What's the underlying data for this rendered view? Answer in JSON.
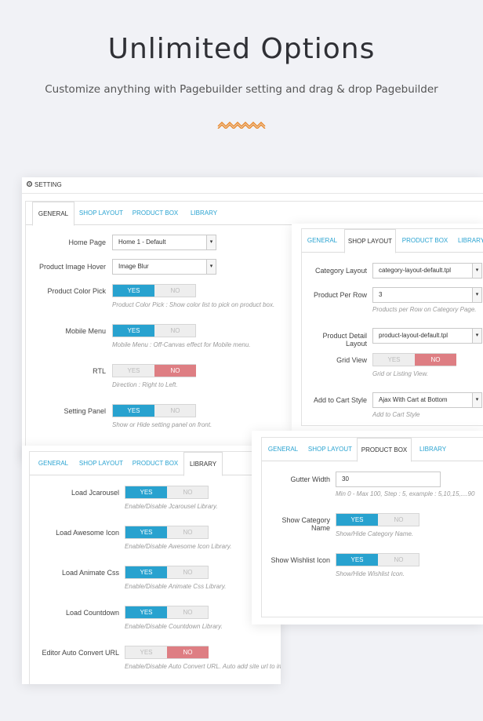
{
  "hero": {
    "title": "Unlimited Options",
    "subtitle": "Customize anything with Pagebuilder setting and drag & drop Pagebuilder",
    "accent_color": "#e8892c"
  },
  "colors": {
    "primary": "#28a2cf",
    "danger": "#de7e83",
    "tab_link": "#2aa3d1"
  },
  "general_panel": {
    "header": "SETTING",
    "tabs": [
      "GENERAL",
      "SHOP LAYOUT",
      "PRODUCT BOX",
      "LIBRARY"
    ],
    "active_tab": "GENERAL",
    "fields": {
      "home_page": {
        "label": "Home Page",
        "value": "Home 1 - Default"
      },
      "product_image_hover": {
        "label": "Product Image Hover",
        "value": "Image Blur"
      },
      "product_color_pick": {
        "label": "Product Color Pick",
        "state": "YES",
        "hint": "Product Color Pick : Show color list to pick on product box."
      },
      "mobile_menu": {
        "label": "Mobile Menu",
        "state": "YES",
        "hint": "Mobile Menu : Off-Canvas effect for Mobile menu."
      },
      "rtl": {
        "label": "RTL",
        "state": "NO",
        "hint": "Direction : Right to Left."
      },
      "setting_panel": {
        "label": "Setting Panel",
        "state": "YES",
        "hint": "Show or Hide setting panel on front."
      }
    }
  },
  "shop_layout_panel": {
    "tabs": [
      "GENERAL",
      "SHOP LAYOUT",
      "PRODUCT BOX",
      "LIBRARY"
    ],
    "active_tab": "SHOP LAYOUT",
    "fields": {
      "category_layout": {
        "label": "Category Layout",
        "value": "category-layout-default.tpl"
      },
      "product_per_row": {
        "label": "Product Per Row",
        "value": "3",
        "hint": "Products per Row on Category Page."
      },
      "product_detail_layout": {
        "label": "Product Detail Layout",
        "value": "product-layout-default.tpl"
      },
      "grid_view": {
        "label": "Grid View",
        "state": "NO",
        "hint": "Grid or Listing View."
      },
      "add_to_cart_style": {
        "label": "Add to Cart Style",
        "value": "Ajax With Cart at Bottom",
        "hint": "Add to Cart Style"
      }
    }
  },
  "library_panel": {
    "tabs": [
      "GENERAL",
      "SHOP LAYOUT",
      "PRODUCT BOX",
      "LIBRARY"
    ],
    "active_tab": "LIBRARY",
    "fields": {
      "load_jcarousel": {
        "label": "Load Jcarousel",
        "state": "YES",
        "hint": "Enable/Disable Jcarousel Library."
      },
      "load_awesome_icon": {
        "label": "Load Awesome Icon",
        "state": "YES",
        "hint": "Enable/Disable Awesome Icon Library."
      },
      "load_animate_css": {
        "label": "Load Animate Css",
        "state": "YES",
        "hint": "Enable/Disable Animate Css Library."
      },
      "load_countdown": {
        "label": "Load Countdown",
        "state": "YES",
        "hint": "Enable/Disable Countdown Library."
      },
      "editor_auto_convert_url": {
        "label": "Editor Auto Convert URL",
        "state": "NO",
        "hint": "Enable/Disable Auto Convert URL. Auto add site url to image src."
      }
    }
  },
  "product_box_panel": {
    "tabs": [
      "GENERAL",
      "SHOP LAYOUT",
      "PRODUCT BOX",
      "LIBRARY"
    ],
    "active_tab": "PRODUCT BOX",
    "fields": {
      "gutter_width": {
        "label": "Gutter Width",
        "value": "30",
        "hint": "Min 0 - Max 100, Step : 5, example : 5,10,15,....90"
      },
      "show_category_name": {
        "label": "Show Category Name",
        "state": "YES",
        "hint": "Show/Hide Category Name."
      },
      "show_wishlist_icon": {
        "label": "Show Wishlist Icon",
        "state": "YES",
        "hint": "Show/Hide Wishlist Icon."
      }
    }
  },
  "toggle_labels": {
    "yes": "YES",
    "no": "NO"
  }
}
